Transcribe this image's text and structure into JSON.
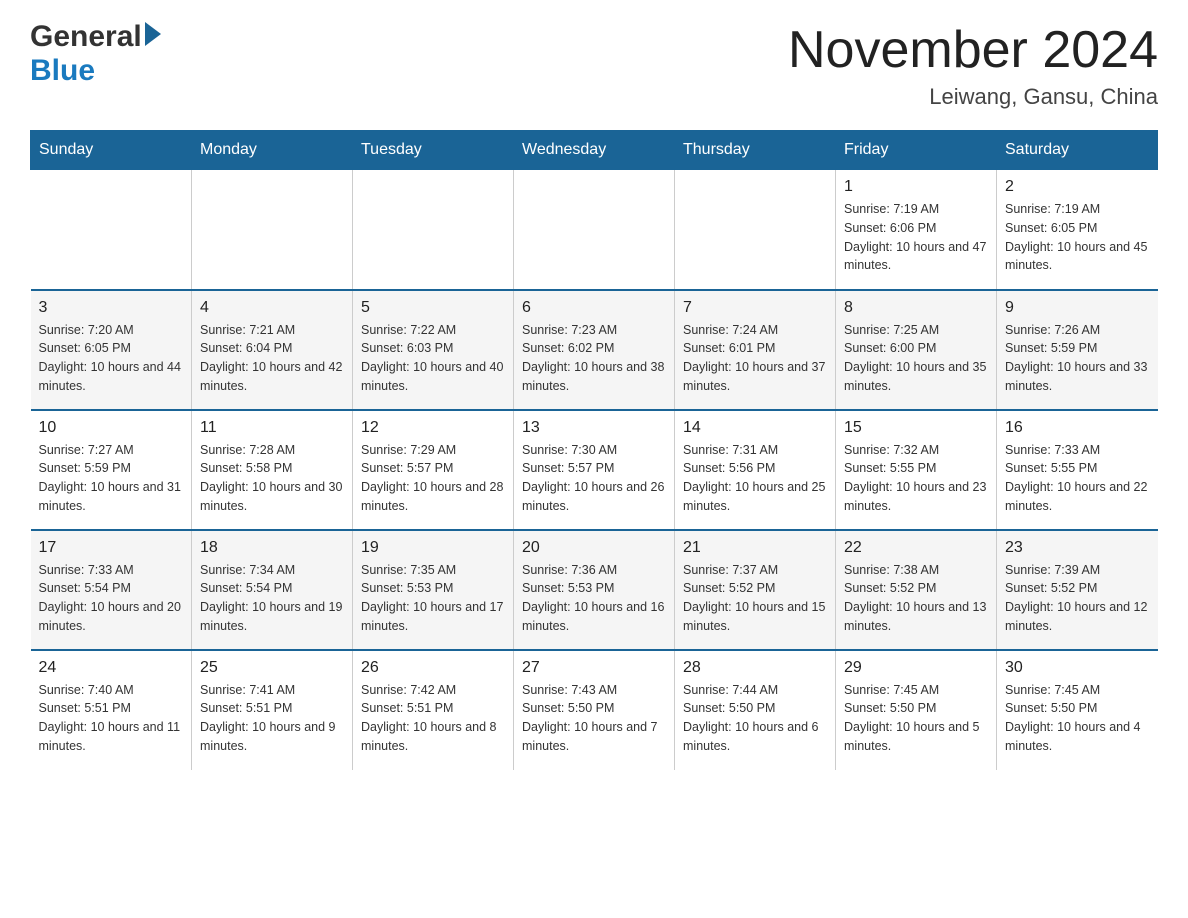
{
  "header": {
    "logo_general": "General",
    "logo_blue": "Blue",
    "month_title": "November 2024",
    "location": "Leiwang, Gansu, China"
  },
  "days_of_week": [
    "Sunday",
    "Monday",
    "Tuesday",
    "Wednesday",
    "Thursday",
    "Friday",
    "Saturday"
  ],
  "weeks": [
    [
      {
        "day": "",
        "sunrise": "",
        "sunset": "",
        "daylight": ""
      },
      {
        "day": "",
        "sunrise": "",
        "sunset": "",
        "daylight": ""
      },
      {
        "day": "",
        "sunrise": "",
        "sunset": "",
        "daylight": ""
      },
      {
        "day": "",
        "sunrise": "",
        "sunset": "",
        "daylight": ""
      },
      {
        "day": "",
        "sunrise": "",
        "sunset": "",
        "daylight": ""
      },
      {
        "day": "1",
        "sunrise": "Sunrise: 7:19 AM",
        "sunset": "Sunset: 6:06 PM",
        "daylight": "Daylight: 10 hours and 47 minutes."
      },
      {
        "day": "2",
        "sunrise": "Sunrise: 7:19 AM",
        "sunset": "Sunset: 6:05 PM",
        "daylight": "Daylight: 10 hours and 45 minutes."
      }
    ],
    [
      {
        "day": "3",
        "sunrise": "Sunrise: 7:20 AM",
        "sunset": "Sunset: 6:05 PM",
        "daylight": "Daylight: 10 hours and 44 minutes."
      },
      {
        "day": "4",
        "sunrise": "Sunrise: 7:21 AM",
        "sunset": "Sunset: 6:04 PM",
        "daylight": "Daylight: 10 hours and 42 minutes."
      },
      {
        "day": "5",
        "sunrise": "Sunrise: 7:22 AM",
        "sunset": "Sunset: 6:03 PM",
        "daylight": "Daylight: 10 hours and 40 minutes."
      },
      {
        "day": "6",
        "sunrise": "Sunrise: 7:23 AM",
        "sunset": "Sunset: 6:02 PM",
        "daylight": "Daylight: 10 hours and 38 minutes."
      },
      {
        "day": "7",
        "sunrise": "Sunrise: 7:24 AM",
        "sunset": "Sunset: 6:01 PM",
        "daylight": "Daylight: 10 hours and 37 minutes."
      },
      {
        "day": "8",
        "sunrise": "Sunrise: 7:25 AM",
        "sunset": "Sunset: 6:00 PM",
        "daylight": "Daylight: 10 hours and 35 minutes."
      },
      {
        "day": "9",
        "sunrise": "Sunrise: 7:26 AM",
        "sunset": "Sunset: 5:59 PM",
        "daylight": "Daylight: 10 hours and 33 minutes."
      }
    ],
    [
      {
        "day": "10",
        "sunrise": "Sunrise: 7:27 AM",
        "sunset": "Sunset: 5:59 PM",
        "daylight": "Daylight: 10 hours and 31 minutes."
      },
      {
        "day": "11",
        "sunrise": "Sunrise: 7:28 AM",
        "sunset": "Sunset: 5:58 PM",
        "daylight": "Daylight: 10 hours and 30 minutes."
      },
      {
        "day": "12",
        "sunrise": "Sunrise: 7:29 AM",
        "sunset": "Sunset: 5:57 PM",
        "daylight": "Daylight: 10 hours and 28 minutes."
      },
      {
        "day": "13",
        "sunrise": "Sunrise: 7:30 AM",
        "sunset": "Sunset: 5:57 PM",
        "daylight": "Daylight: 10 hours and 26 minutes."
      },
      {
        "day": "14",
        "sunrise": "Sunrise: 7:31 AM",
        "sunset": "Sunset: 5:56 PM",
        "daylight": "Daylight: 10 hours and 25 minutes."
      },
      {
        "day": "15",
        "sunrise": "Sunrise: 7:32 AM",
        "sunset": "Sunset: 5:55 PM",
        "daylight": "Daylight: 10 hours and 23 minutes."
      },
      {
        "day": "16",
        "sunrise": "Sunrise: 7:33 AM",
        "sunset": "Sunset: 5:55 PM",
        "daylight": "Daylight: 10 hours and 22 minutes."
      }
    ],
    [
      {
        "day": "17",
        "sunrise": "Sunrise: 7:33 AM",
        "sunset": "Sunset: 5:54 PM",
        "daylight": "Daylight: 10 hours and 20 minutes."
      },
      {
        "day": "18",
        "sunrise": "Sunrise: 7:34 AM",
        "sunset": "Sunset: 5:54 PM",
        "daylight": "Daylight: 10 hours and 19 minutes."
      },
      {
        "day": "19",
        "sunrise": "Sunrise: 7:35 AM",
        "sunset": "Sunset: 5:53 PM",
        "daylight": "Daylight: 10 hours and 17 minutes."
      },
      {
        "day": "20",
        "sunrise": "Sunrise: 7:36 AM",
        "sunset": "Sunset: 5:53 PM",
        "daylight": "Daylight: 10 hours and 16 minutes."
      },
      {
        "day": "21",
        "sunrise": "Sunrise: 7:37 AM",
        "sunset": "Sunset: 5:52 PM",
        "daylight": "Daylight: 10 hours and 15 minutes."
      },
      {
        "day": "22",
        "sunrise": "Sunrise: 7:38 AM",
        "sunset": "Sunset: 5:52 PM",
        "daylight": "Daylight: 10 hours and 13 minutes."
      },
      {
        "day": "23",
        "sunrise": "Sunrise: 7:39 AM",
        "sunset": "Sunset: 5:52 PM",
        "daylight": "Daylight: 10 hours and 12 minutes."
      }
    ],
    [
      {
        "day": "24",
        "sunrise": "Sunrise: 7:40 AM",
        "sunset": "Sunset: 5:51 PM",
        "daylight": "Daylight: 10 hours and 11 minutes."
      },
      {
        "day": "25",
        "sunrise": "Sunrise: 7:41 AM",
        "sunset": "Sunset: 5:51 PM",
        "daylight": "Daylight: 10 hours and 9 minutes."
      },
      {
        "day": "26",
        "sunrise": "Sunrise: 7:42 AM",
        "sunset": "Sunset: 5:51 PM",
        "daylight": "Daylight: 10 hours and 8 minutes."
      },
      {
        "day": "27",
        "sunrise": "Sunrise: 7:43 AM",
        "sunset": "Sunset: 5:50 PM",
        "daylight": "Daylight: 10 hours and 7 minutes."
      },
      {
        "day": "28",
        "sunrise": "Sunrise: 7:44 AM",
        "sunset": "Sunset: 5:50 PM",
        "daylight": "Daylight: 10 hours and 6 minutes."
      },
      {
        "day": "29",
        "sunrise": "Sunrise: 7:45 AM",
        "sunset": "Sunset: 5:50 PM",
        "daylight": "Daylight: 10 hours and 5 minutes."
      },
      {
        "day": "30",
        "sunrise": "Sunrise: 7:45 AM",
        "sunset": "Sunset: 5:50 PM",
        "daylight": "Daylight: 10 hours and 4 minutes."
      }
    ]
  ]
}
